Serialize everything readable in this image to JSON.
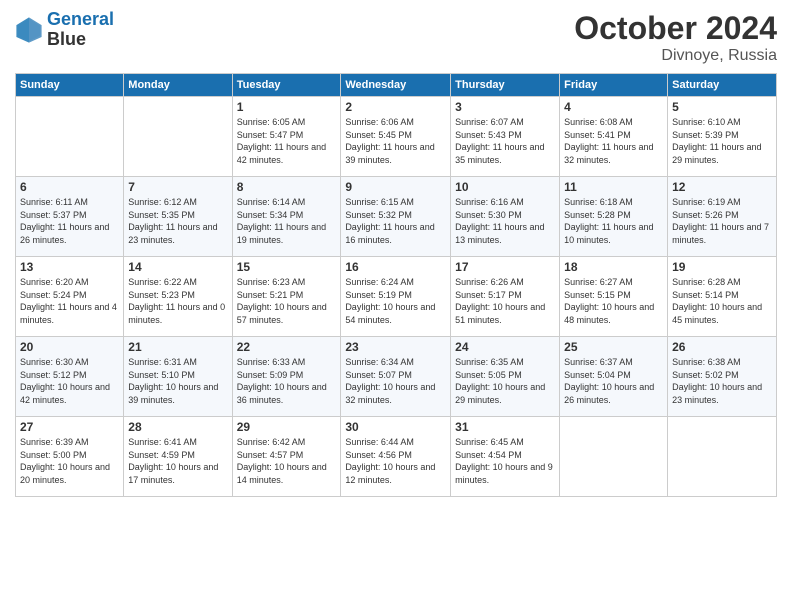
{
  "header": {
    "logo_line1": "General",
    "logo_line2": "Blue",
    "month": "October 2024",
    "location": "Divnoye, Russia"
  },
  "columns": [
    "Sunday",
    "Monday",
    "Tuesday",
    "Wednesday",
    "Thursday",
    "Friday",
    "Saturday"
  ],
  "weeks": [
    [
      {
        "day": "",
        "sunrise": "",
        "sunset": "",
        "daylight": ""
      },
      {
        "day": "",
        "sunrise": "",
        "sunset": "",
        "daylight": ""
      },
      {
        "day": "1",
        "sunrise": "Sunrise: 6:05 AM",
        "sunset": "Sunset: 5:47 PM",
        "daylight": "Daylight: 11 hours and 42 minutes."
      },
      {
        "day": "2",
        "sunrise": "Sunrise: 6:06 AM",
        "sunset": "Sunset: 5:45 PM",
        "daylight": "Daylight: 11 hours and 39 minutes."
      },
      {
        "day": "3",
        "sunrise": "Sunrise: 6:07 AM",
        "sunset": "Sunset: 5:43 PM",
        "daylight": "Daylight: 11 hours and 35 minutes."
      },
      {
        "day": "4",
        "sunrise": "Sunrise: 6:08 AM",
        "sunset": "Sunset: 5:41 PM",
        "daylight": "Daylight: 11 hours and 32 minutes."
      },
      {
        "day": "5",
        "sunrise": "Sunrise: 6:10 AM",
        "sunset": "Sunset: 5:39 PM",
        "daylight": "Daylight: 11 hours and 29 minutes."
      }
    ],
    [
      {
        "day": "6",
        "sunrise": "Sunrise: 6:11 AM",
        "sunset": "Sunset: 5:37 PM",
        "daylight": "Daylight: 11 hours and 26 minutes."
      },
      {
        "day": "7",
        "sunrise": "Sunrise: 6:12 AM",
        "sunset": "Sunset: 5:35 PM",
        "daylight": "Daylight: 11 hours and 23 minutes."
      },
      {
        "day": "8",
        "sunrise": "Sunrise: 6:14 AM",
        "sunset": "Sunset: 5:34 PM",
        "daylight": "Daylight: 11 hours and 19 minutes."
      },
      {
        "day": "9",
        "sunrise": "Sunrise: 6:15 AM",
        "sunset": "Sunset: 5:32 PM",
        "daylight": "Daylight: 11 hours and 16 minutes."
      },
      {
        "day": "10",
        "sunrise": "Sunrise: 6:16 AM",
        "sunset": "Sunset: 5:30 PM",
        "daylight": "Daylight: 11 hours and 13 minutes."
      },
      {
        "day": "11",
        "sunrise": "Sunrise: 6:18 AM",
        "sunset": "Sunset: 5:28 PM",
        "daylight": "Daylight: 11 hours and 10 minutes."
      },
      {
        "day": "12",
        "sunrise": "Sunrise: 6:19 AM",
        "sunset": "Sunset: 5:26 PM",
        "daylight": "Daylight: 11 hours and 7 minutes."
      }
    ],
    [
      {
        "day": "13",
        "sunrise": "Sunrise: 6:20 AM",
        "sunset": "Sunset: 5:24 PM",
        "daylight": "Daylight: 11 hours and 4 minutes."
      },
      {
        "day": "14",
        "sunrise": "Sunrise: 6:22 AM",
        "sunset": "Sunset: 5:23 PM",
        "daylight": "Daylight: 11 hours and 0 minutes."
      },
      {
        "day": "15",
        "sunrise": "Sunrise: 6:23 AM",
        "sunset": "Sunset: 5:21 PM",
        "daylight": "Daylight: 10 hours and 57 minutes."
      },
      {
        "day": "16",
        "sunrise": "Sunrise: 6:24 AM",
        "sunset": "Sunset: 5:19 PM",
        "daylight": "Daylight: 10 hours and 54 minutes."
      },
      {
        "day": "17",
        "sunrise": "Sunrise: 6:26 AM",
        "sunset": "Sunset: 5:17 PM",
        "daylight": "Daylight: 10 hours and 51 minutes."
      },
      {
        "day": "18",
        "sunrise": "Sunrise: 6:27 AM",
        "sunset": "Sunset: 5:15 PM",
        "daylight": "Daylight: 10 hours and 48 minutes."
      },
      {
        "day": "19",
        "sunrise": "Sunrise: 6:28 AM",
        "sunset": "Sunset: 5:14 PM",
        "daylight": "Daylight: 10 hours and 45 minutes."
      }
    ],
    [
      {
        "day": "20",
        "sunrise": "Sunrise: 6:30 AM",
        "sunset": "Sunset: 5:12 PM",
        "daylight": "Daylight: 10 hours and 42 minutes."
      },
      {
        "day": "21",
        "sunrise": "Sunrise: 6:31 AM",
        "sunset": "Sunset: 5:10 PM",
        "daylight": "Daylight: 10 hours and 39 minutes."
      },
      {
        "day": "22",
        "sunrise": "Sunrise: 6:33 AM",
        "sunset": "Sunset: 5:09 PM",
        "daylight": "Daylight: 10 hours and 36 minutes."
      },
      {
        "day": "23",
        "sunrise": "Sunrise: 6:34 AM",
        "sunset": "Sunset: 5:07 PM",
        "daylight": "Daylight: 10 hours and 32 minutes."
      },
      {
        "day": "24",
        "sunrise": "Sunrise: 6:35 AM",
        "sunset": "Sunset: 5:05 PM",
        "daylight": "Daylight: 10 hours and 29 minutes."
      },
      {
        "day": "25",
        "sunrise": "Sunrise: 6:37 AM",
        "sunset": "Sunset: 5:04 PM",
        "daylight": "Daylight: 10 hours and 26 minutes."
      },
      {
        "day": "26",
        "sunrise": "Sunrise: 6:38 AM",
        "sunset": "Sunset: 5:02 PM",
        "daylight": "Daylight: 10 hours and 23 minutes."
      }
    ],
    [
      {
        "day": "27",
        "sunrise": "Sunrise: 6:39 AM",
        "sunset": "Sunset: 5:00 PM",
        "daylight": "Daylight: 10 hours and 20 minutes."
      },
      {
        "day": "28",
        "sunrise": "Sunrise: 6:41 AM",
        "sunset": "Sunset: 4:59 PM",
        "daylight": "Daylight: 10 hours and 17 minutes."
      },
      {
        "day": "29",
        "sunrise": "Sunrise: 6:42 AM",
        "sunset": "Sunset: 4:57 PM",
        "daylight": "Daylight: 10 hours and 14 minutes."
      },
      {
        "day": "30",
        "sunrise": "Sunrise: 6:44 AM",
        "sunset": "Sunset: 4:56 PM",
        "daylight": "Daylight: 10 hours and 12 minutes."
      },
      {
        "day": "31",
        "sunrise": "Sunrise: 6:45 AM",
        "sunset": "Sunset: 4:54 PM",
        "daylight": "Daylight: 10 hours and 9 minutes."
      },
      {
        "day": "",
        "sunrise": "",
        "sunset": "",
        "daylight": ""
      },
      {
        "day": "",
        "sunrise": "",
        "sunset": "",
        "daylight": ""
      }
    ]
  ]
}
